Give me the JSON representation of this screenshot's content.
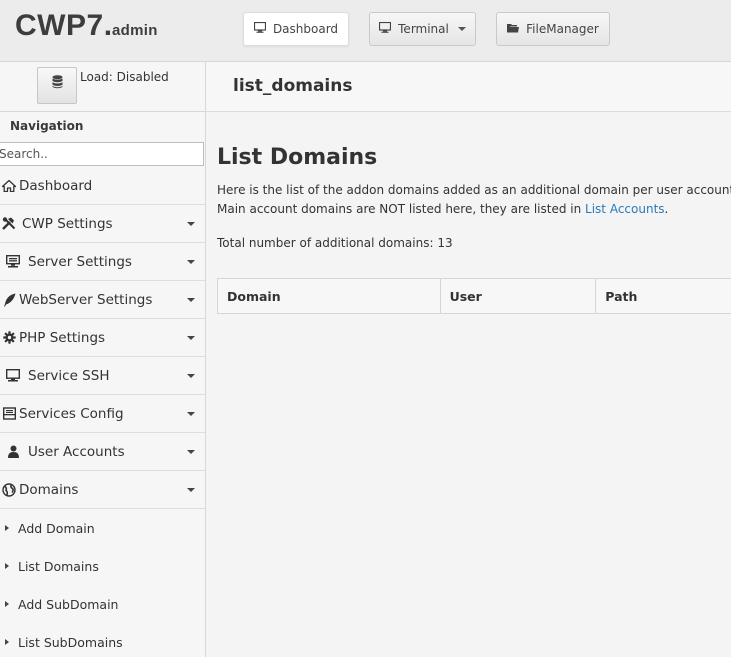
{
  "header": {
    "logo_main": "CWP7",
    "logo_dot": ".",
    "logo_sub": "admin",
    "buttons": {
      "dashboard": "Dashboard",
      "terminal": "Terminal",
      "filemanager": "FileManager"
    }
  },
  "sidebar": {
    "load_label": "Load: Disabled",
    "nav_title": "Navigation",
    "search_placeholder": "Search..",
    "items": [
      {
        "label": "Dashboard",
        "icon": "home-icon"
      },
      {
        "label": "CWP Settings",
        "icon": "tools-icon"
      },
      {
        "label": "Server Settings",
        "icon": "server-icon"
      },
      {
        "label": "WebServer Settings",
        "icon": "feather-icon"
      },
      {
        "label": "PHP Settings",
        "icon": "gear-icon"
      },
      {
        "label": "Service SSH",
        "icon": "monitor-icon"
      },
      {
        "label": "Services Config",
        "icon": "inbox-icon"
      },
      {
        "label": "User Accounts",
        "icon": "user-icon"
      },
      {
        "label": "Domains",
        "icon": "globe-icon"
      }
    ],
    "sub_items": [
      {
        "label": "Add Domain"
      },
      {
        "label": "List Domains"
      },
      {
        "label": "Add SubDomain"
      },
      {
        "label": "List SubDomains"
      }
    ]
  },
  "main": {
    "breadcrumb_title": "list_domains",
    "heading": "List Domains",
    "desc_line1": "Here is the list of the addon domains added as an additional domain per user account.",
    "desc_line2": "Main account domains are NOT listed here, they are listed in",
    "desc_link": "List Accounts",
    "desc_end": ".",
    "total_text": "Total number of additional domains: 13",
    "table": {
      "columns": [
        "Domain",
        "User",
        "Path"
      ]
    }
  },
  "colors": {
    "link": "#2a7ab8",
    "header_bg": "#ececec",
    "sidebar_bg": "#f6f6f6"
  }
}
